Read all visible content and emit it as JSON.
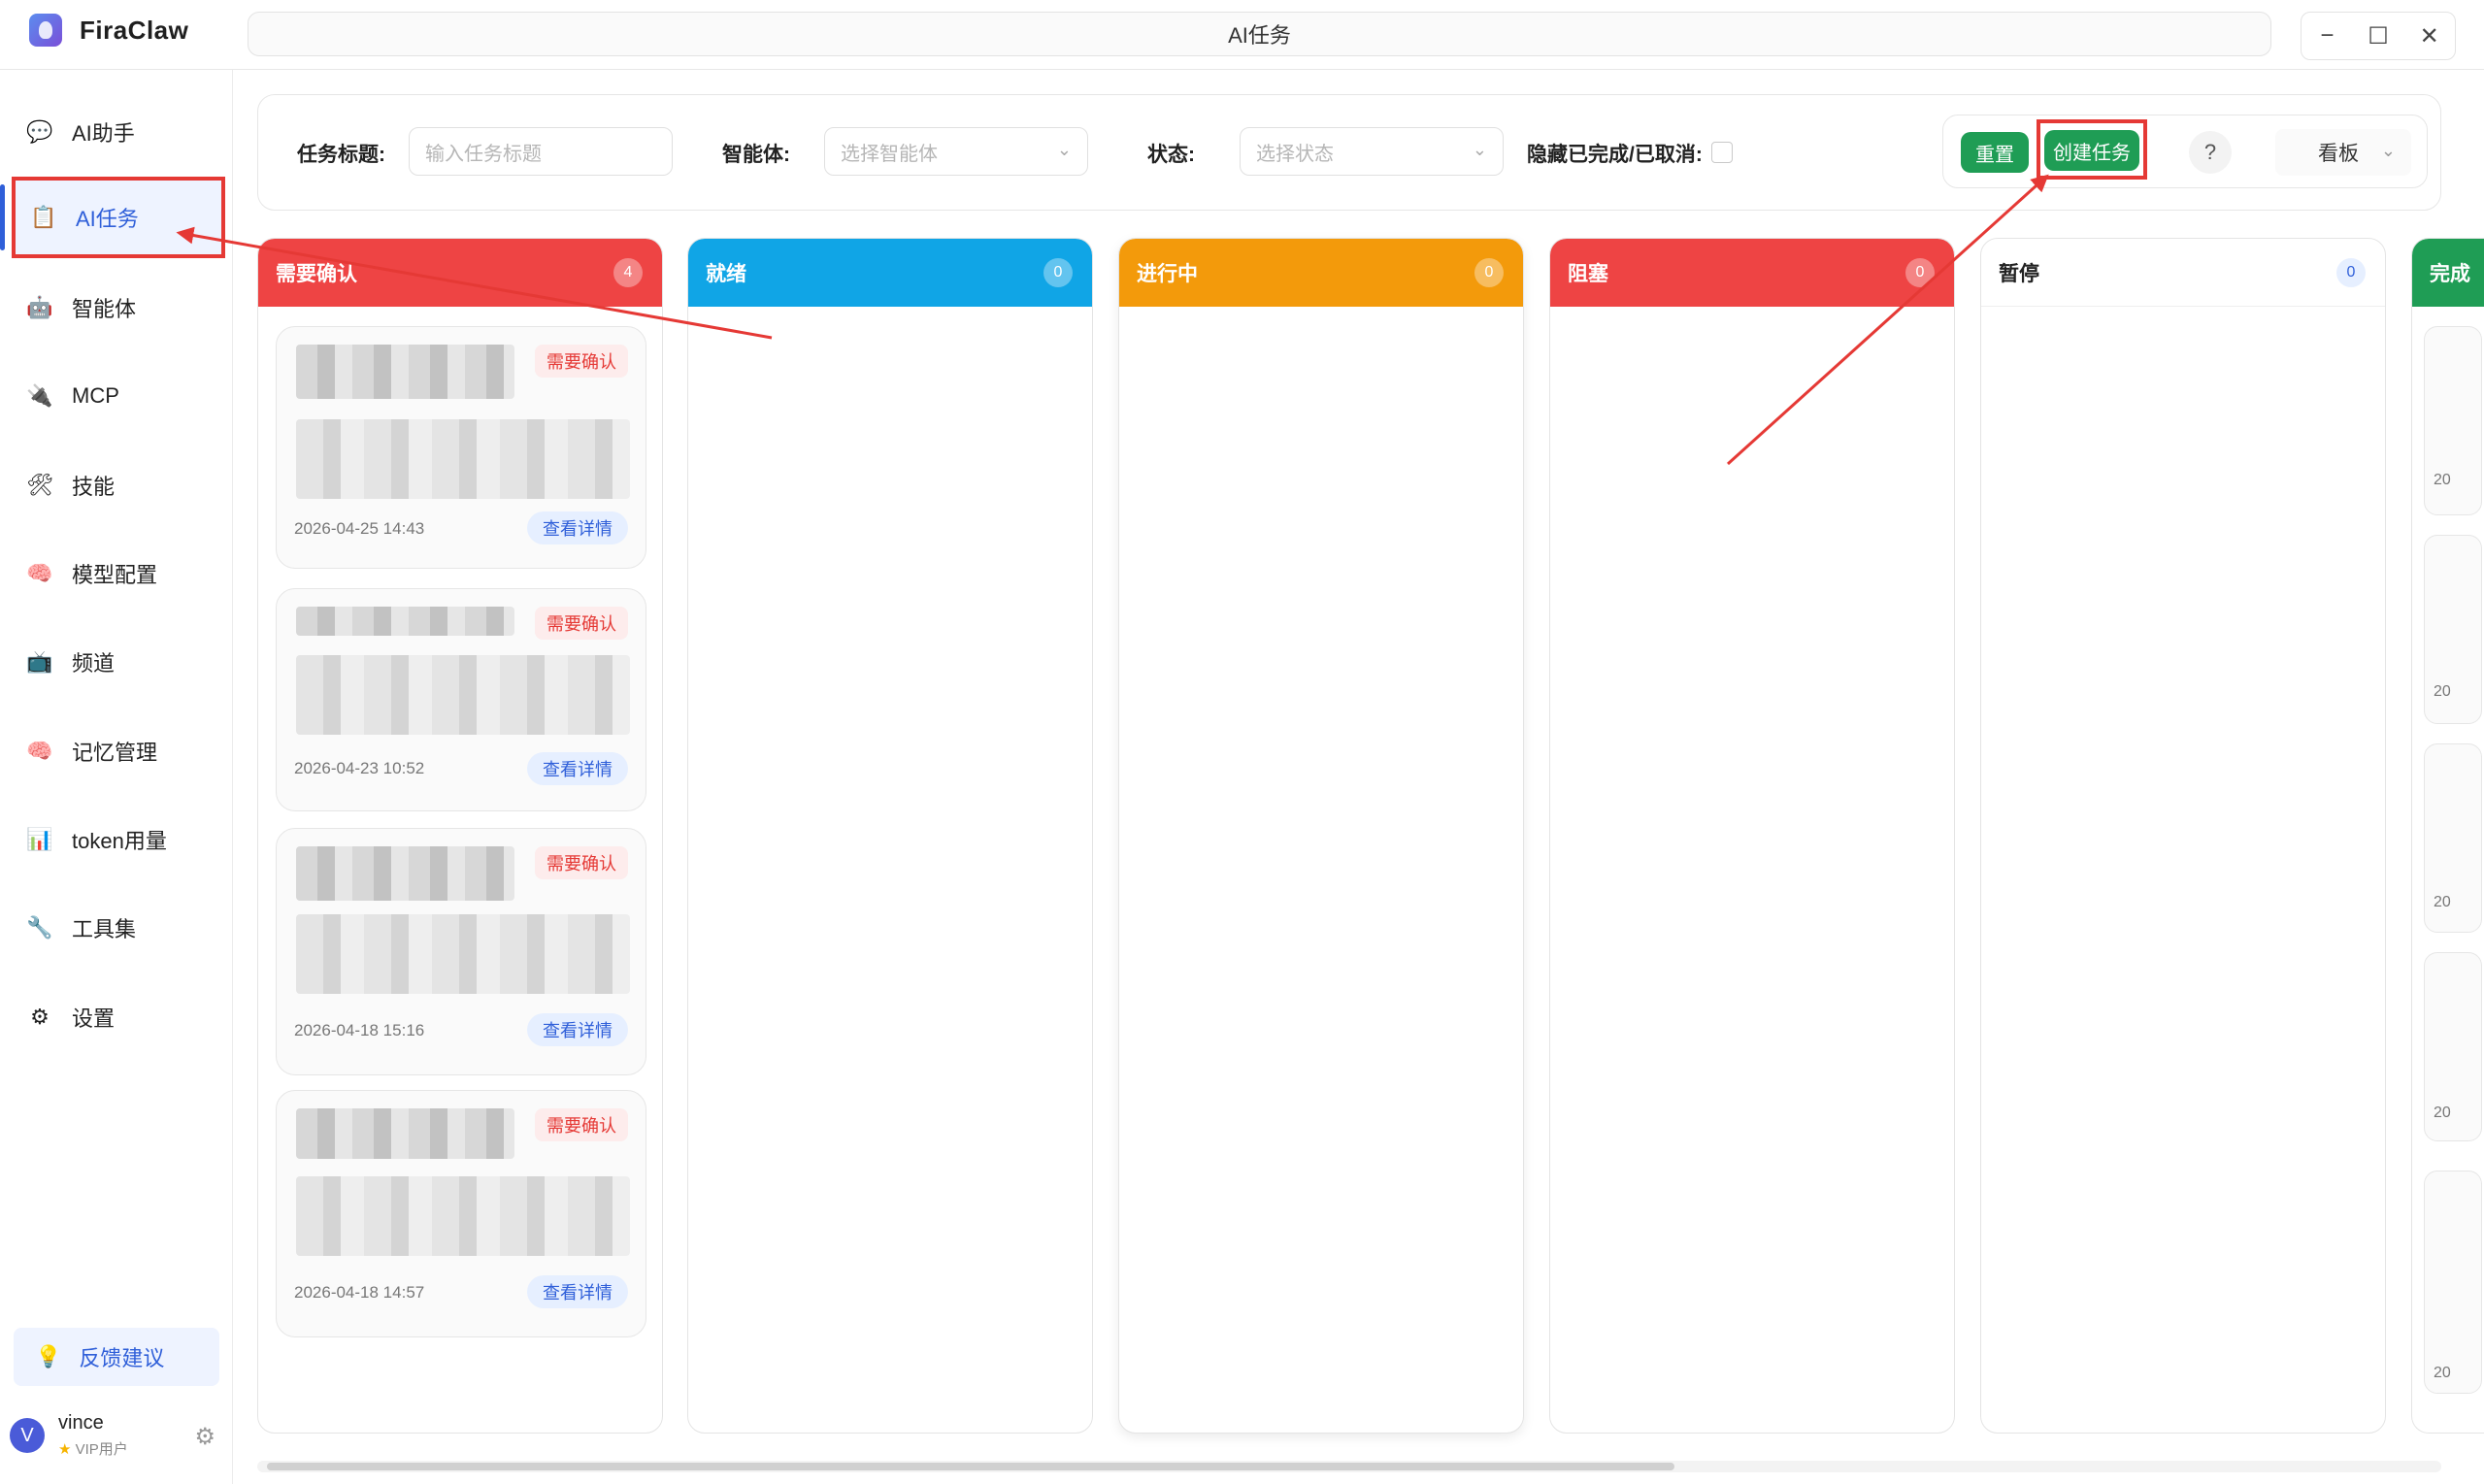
{
  "app": {
    "name": "FiraClaw",
    "window_title": "AI任务",
    "minimize": "−",
    "maximize": "☐",
    "close": "✕"
  },
  "sidebar": {
    "items": [
      {
        "label": "AI助手",
        "icon": "chat-icon",
        "glyph": "💬"
      },
      {
        "label": "AI任务",
        "icon": "clipboard-icon",
        "glyph": "📋",
        "active": true
      },
      {
        "label": "智能体",
        "icon": "robot-icon",
        "glyph": "🤖"
      },
      {
        "label": "MCP",
        "icon": "plug-icon",
        "glyph": "🔌"
      },
      {
        "label": "技能",
        "icon": "tools-icon",
        "glyph": "🛠"
      },
      {
        "label": "模型配置",
        "icon": "brain-icon",
        "glyph": "🧠"
      },
      {
        "label": "频道",
        "icon": "tv-icon",
        "glyph": "📺"
      },
      {
        "label": "记忆管理",
        "icon": "brain-icon",
        "glyph": "🧠"
      },
      {
        "label": "token用量",
        "icon": "bar-chart-icon",
        "glyph": "📊"
      },
      {
        "label": "工具集",
        "icon": "wrench-icon",
        "glyph": "🔧"
      },
      {
        "label": "设置",
        "icon": "gear-icon",
        "glyph": "⚙"
      }
    ],
    "feedback": {
      "label": "反馈建议",
      "glyph": "💡"
    },
    "user": {
      "initial": "V",
      "name": "vince",
      "level": "VIP用户",
      "star": "★",
      "gear": "⚙"
    }
  },
  "filters": {
    "title_label": "任务标题:",
    "title_placeholder": "输入任务标题",
    "agent_label": "智能体:",
    "agent_placeholder": "选择智能体",
    "status_label": "状态:",
    "status_placeholder": "选择状态",
    "hide_label": "隐藏已完成/已取消:",
    "chevron": "⌄",
    "reset": "重置",
    "create": "创建任务",
    "help": "?",
    "view": "看板"
  },
  "columns": [
    {
      "title": "需要确认",
      "count": "4",
      "color": "#ee4444"
    },
    {
      "title": "就绪",
      "count": "0",
      "color": "#10a5e6"
    },
    {
      "title": "进行中",
      "count": "0",
      "color": "#f39a0b"
    },
    {
      "title": "阻塞",
      "count": "0",
      "color": "#ee4444"
    },
    {
      "title": "暂停",
      "count": "0",
      "color": "#ffffff"
    },
    {
      "title": "完成",
      "count": "",
      "color": "#1f9d55"
    }
  ],
  "cards": [
    {
      "tag": "需要确认",
      "date": "2026-04-25 14:43",
      "link": "查看详情"
    },
    {
      "tag": "需要确认",
      "date": "2026-04-23 10:52",
      "link": "查看详情"
    },
    {
      "tag": "需要确认",
      "date": "2026-04-18 15:16",
      "link": "查看详情"
    },
    {
      "tag": "需要确认",
      "date": "2026-04-18 14:57",
      "link": "查看详情"
    }
  ],
  "partial_dates": [
    "20",
    "20",
    "20",
    "20",
    "20"
  ],
  "colors": {
    "accent": "#2f5fd9",
    "annotation": "#e53935",
    "success": "#1f9d55"
  }
}
